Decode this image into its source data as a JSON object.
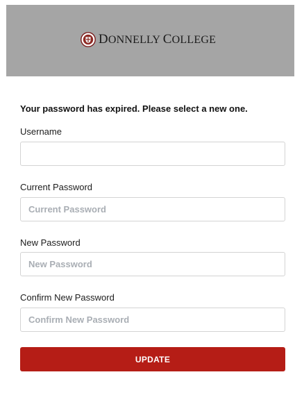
{
  "header": {
    "logo_wordmark_initial_1": "D",
    "logo_wordmark_rest_1": "ONNELLY",
    "logo_wordmark_initial_2": "C",
    "logo_wordmark_rest_2": "OLLEGE",
    "logo_icon": "college-seal-icon",
    "background_color": "#a5a5a5"
  },
  "form": {
    "notice": "Your password has expired. Please select a new one.",
    "username": {
      "label": "Username",
      "value": "",
      "placeholder": ""
    },
    "current_password": {
      "label": "Current Password",
      "value": "",
      "placeholder": "Current Password"
    },
    "new_password": {
      "label": "New Password",
      "value": "",
      "placeholder": "New Password"
    },
    "confirm_password": {
      "label": "Confirm New Password",
      "value": "",
      "placeholder": "Confirm New Password"
    },
    "update_button": {
      "label": "UPDATE",
      "color": "#b51d16"
    }
  }
}
